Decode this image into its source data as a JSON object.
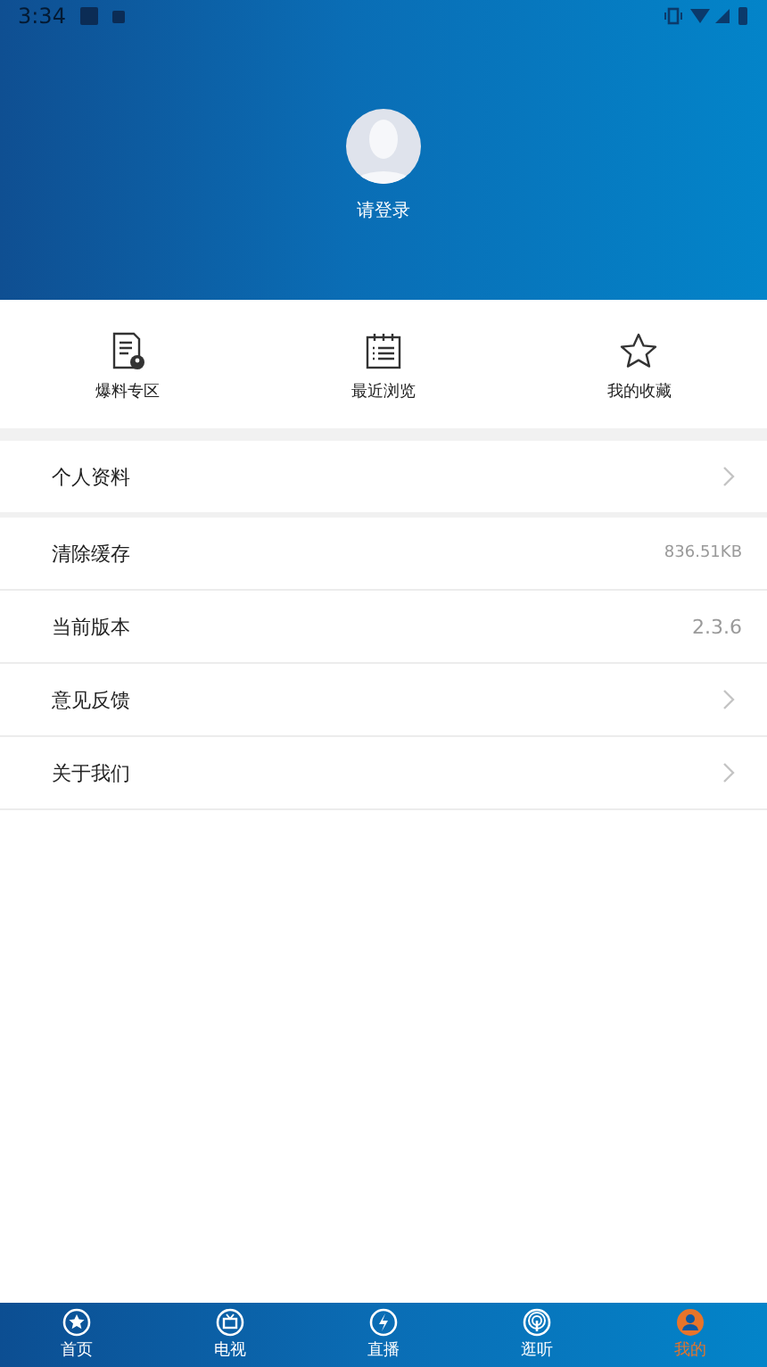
{
  "status_bar": {
    "time": "3:34"
  },
  "profile": {
    "login_label": "请登录"
  },
  "shortcuts": [
    {
      "kind": "report",
      "label": "爆料专区"
    },
    {
      "kind": "history",
      "label": "最近浏览"
    },
    {
      "kind": "favorite",
      "label": "我的收藏"
    }
  ],
  "settings": [
    {
      "label": "个人资料",
      "kind": "link",
      "group_end": true
    },
    {
      "label": "清除缓存",
      "kind": "value",
      "value": "836.51KB",
      "small": true
    },
    {
      "label": "当前版本",
      "kind": "value",
      "value": "2.3.6"
    },
    {
      "label": "意见反馈",
      "kind": "link"
    },
    {
      "label": "关于我们",
      "kind": "link"
    }
  ],
  "tab_bar": [
    {
      "kind": "home",
      "label": "首页",
      "selected": false
    },
    {
      "kind": "tv",
      "label": "电视",
      "selected": false
    },
    {
      "kind": "live",
      "label": "直播",
      "selected": false
    },
    {
      "kind": "radio",
      "label": "逛听",
      "selected": false
    },
    {
      "kind": "me",
      "label": "我的",
      "selected": true
    }
  ]
}
